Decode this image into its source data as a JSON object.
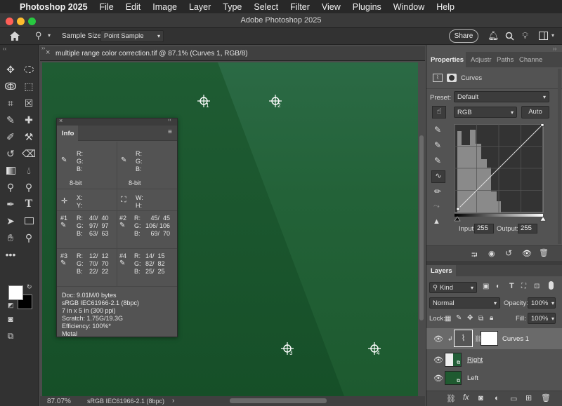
{
  "menubar": {
    "app": "Photoshop 2025",
    "items": [
      "File",
      "Edit",
      "Image",
      "Layer",
      "Type",
      "Select",
      "Filter",
      "View",
      "Plugins",
      "Window",
      "Help"
    ]
  },
  "titlebar": {
    "title": "Adobe Photoshop 2025"
  },
  "options": {
    "sample_size_label": "Sample Size:",
    "sample_size_value": "Point Sample",
    "share_label": "Share"
  },
  "document": {
    "tab_title": "multiple range color correction.tif @ 87.1% (Curves 1, RGB/8)",
    "zoom": "87.07%",
    "profile": "sRGB IEC61966-2.1 (8bpc)"
  },
  "samplers": [
    "1",
    "2",
    "3",
    "4"
  ],
  "info": {
    "title": "Info",
    "rgb_labels": "R:\nG:\nB:",
    "bit_left": "8-bit",
    "bit_right": "8-bit",
    "xy_labels": "X:\nY:",
    "wh_labels": "W:\nH:",
    "s1_id": "#1",
    "s1_vals": "40/  40\n97/  97\n63/  63",
    "s2_id": "#2",
    "s2_vals": "45/  45\n106/ 106\n69/  70",
    "s3_id": "#3",
    "s3_vals": "12/  12\n70/  70\n22/  22",
    "s4_id": "#4",
    "s4_vals": "14/  15\n82/  82\n25/  25",
    "doc_line1": "Doc: 9.01M/0 bytes",
    "doc_line2": "sRGB IEC61966-2.1 (8bpc)",
    "doc_line3": "7 in x 5 in (300 ppi)",
    "doc_line4": "Scratch: 1.75G/19.3G",
    "doc_line5": "Efficiency: 100%*",
    "doc_line6": "Metal"
  },
  "properties": {
    "tabs": [
      "Properties",
      "Adjustr",
      "Paths",
      "Channe"
    ],
    "adj_name": "Curves",
    "preset_label": "Preset:",
    "preset_value": "Default",
    "channel_value": "RGB",
    "auto_label": "Auto",
    "input_label": "Input:",
    "input_value": "255",
    "output_label": "Output:",
    "output_value": "255"
  },
  "layers": {
    "title": "Layers",
    "kind_value": "Kind",
    "blend_value": "Normal",
    "opacity_label": "Opacity:",
    "opacity_value": "100%",
    "lock_label": "Lock:",
    "fill_label": "Fill:",
    "fill_value": "100%",
    "rows": [
      {
        "name": "Curves 1"
      },
      {
        "name": "Right"
      },
      {
        "name": "Left"
      }
    ]
  },
  "colors": {
    "canvas_top": "#2b6a45",
    "canvas_bottom": "#1d5a2f",
    "panel": "#535353",
    "dark": "#323232"
  }
}
